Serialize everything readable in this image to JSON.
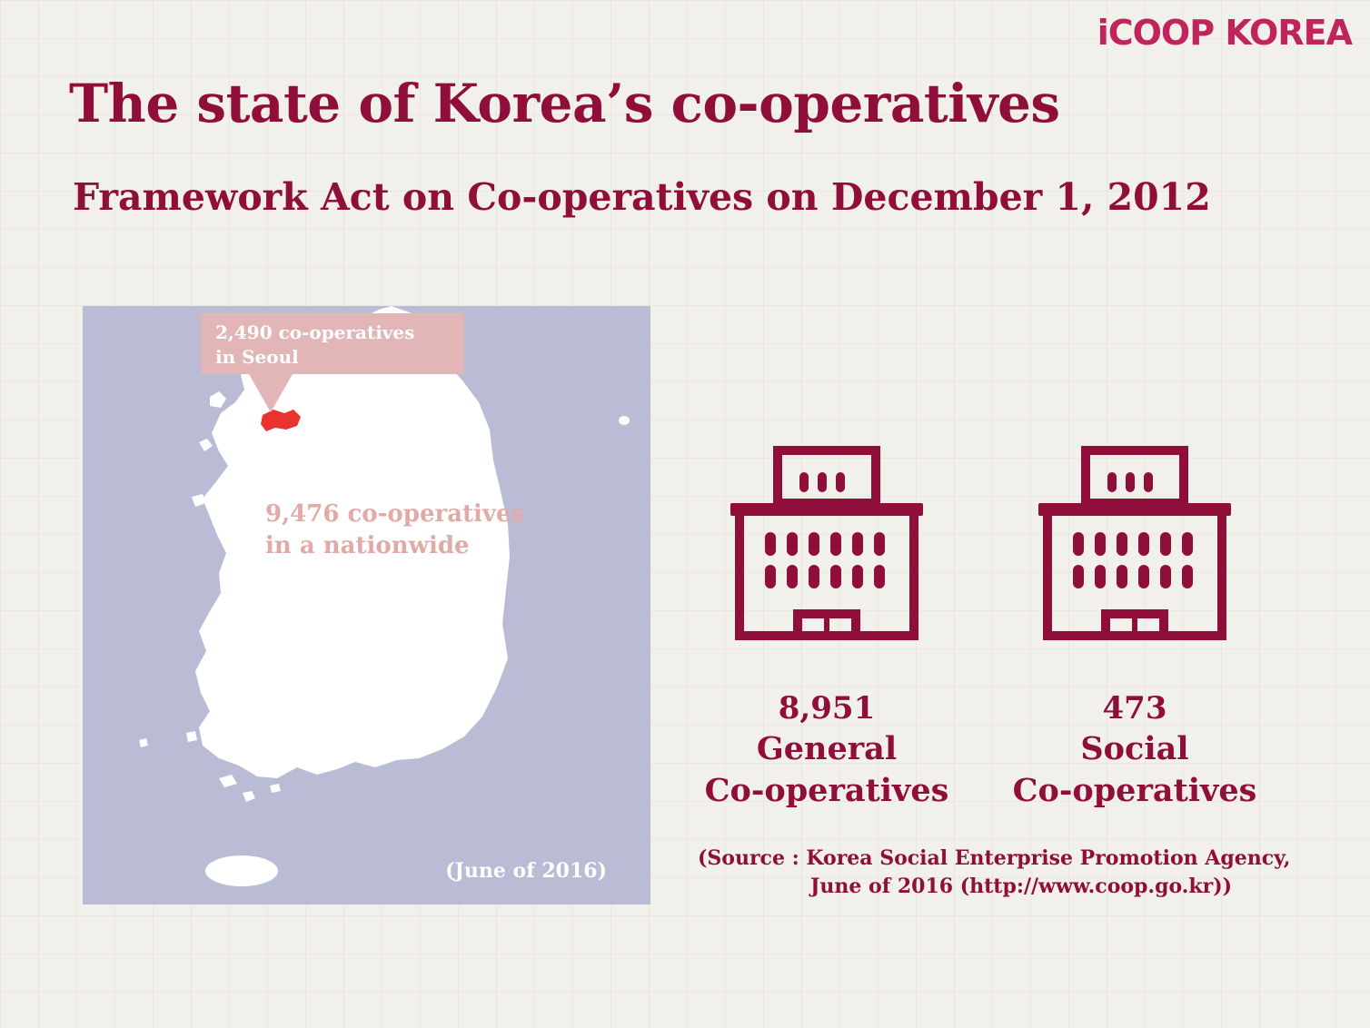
{
  "logo": "iCOOP KOREA",
  "title": "The state of Korea’s co-operatives",
  "subtitle": "Framework Act on Co-operatives on December 1, 2012",
  "map": {
    "callout_line1": "2,490 co-operatives",
    "callout_line2": "in Seoul",
    "nation_line1": "9,476 co-operatives",
    "nation_line2": "in a nationwide",
    "date": "(June of 2016)"
  },
  "stats": [
    {
      "number": "8,951",
      "line1": "General",
      "line2": "Co-operatives",
      "icon": "building-icon"
    },
    {
      "number": "473",
      "line1": "Social",
      "line2": "Co-operatives",
      "icon": "building-icon"
    }
  ],
  "source": {
    "line1": "(Source : Korea Social Enterprise Promotion Agency,",
    "line2": "June  of 2016 (http://www.coop.go.kr))"
  },
  "colors": {
    "brand": "#8f0e3a",
    "logo": "#c0245c",
    "map_sea": "#babcd6",
    "map_land": "#ffffff",
    "seoul_highlight": "#e8332e",
    "callout": "#e2b6b6"
  }
}
